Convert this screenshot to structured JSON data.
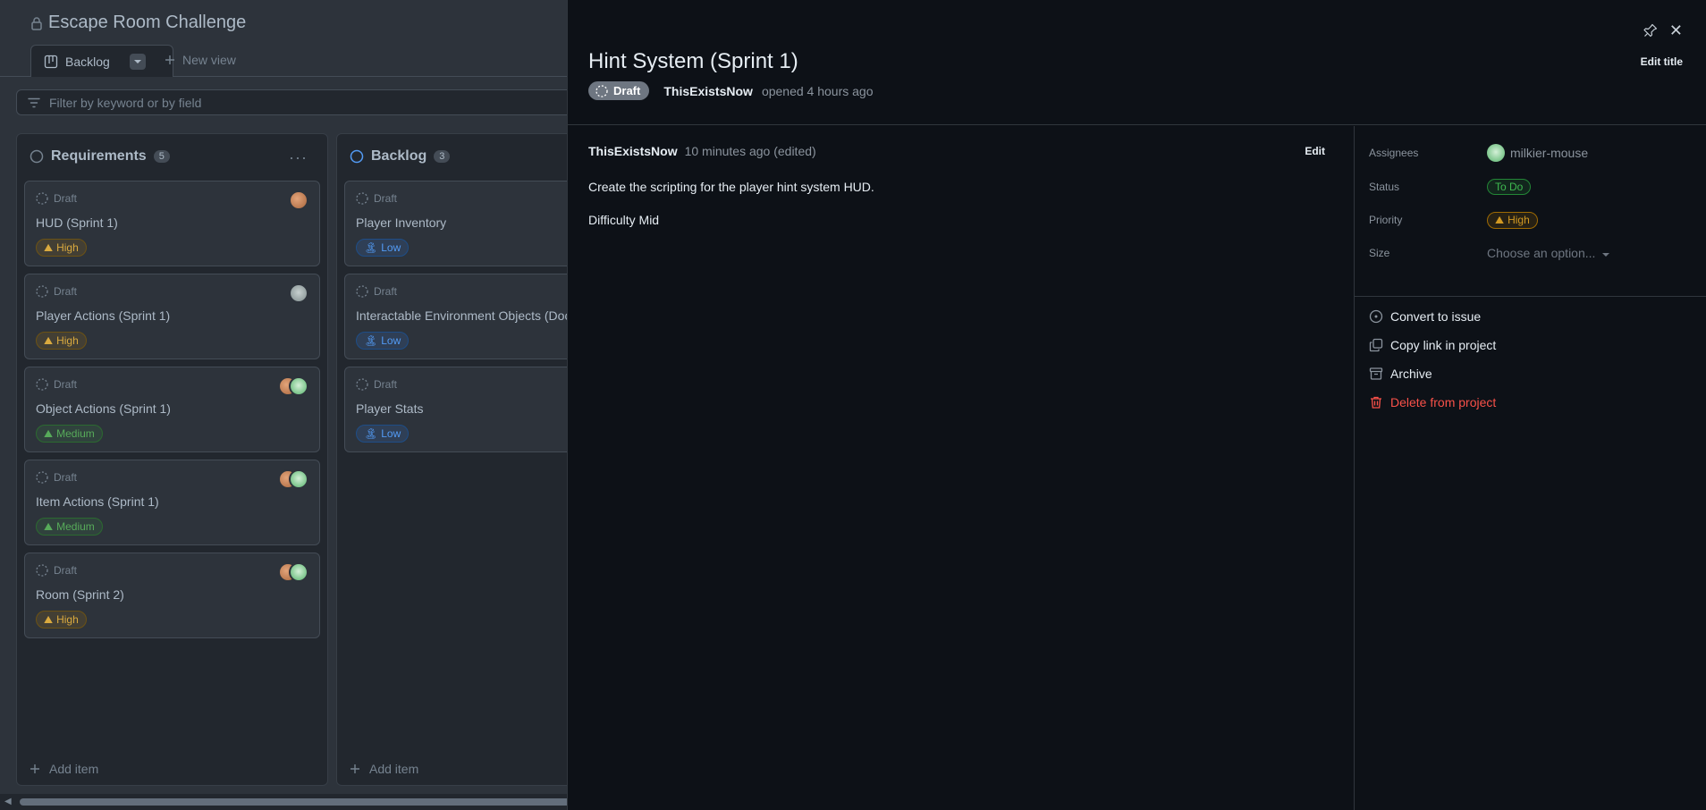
{
  "project": {
    "title": "Escape Room Challenge"
  },
  "views": {
    "active_tab": "Backlog",
    "new_view": "New view"
  },
  "filter": {
    "placeholder": "Filter by keyword or by field"
  },
  "columns": [
    {
      "title": "Requirements",
      "count": "5",
      "add_item": "Add item",
      "cards": [
        {
          "status": "Draft",
          "title": "HUD (Sprint 1)",
          "priority": "High"
        },
        {
          "status": "Draft",
          "title": "Player Actions (Sprint 1)",
          "priority": "High"
        },
        {
          "status": "Draft",
          "title": "Object Actions (Sprint 1)",
          "priority": "Medium"
        },
        {
          "status": "Draft",
          "title": "Item Actions (Sprint 1)",
          "priority": "Medium"
        },
        {
          "status": "Draft",
          "title": "Room (Sprint 2)",
          "priority": "High"
        }
      ]
    },
    {
      "title": "Backlog",
      "count": "3",
      "add_item": "Add item",
      "cards": [
        {
          "status": "Draft",
          "title": "Player Inventory",
          "priority": "Low"
        },
        {
          "status": "Draft",
          "title": "Interactable Environment Objects (Doc",
          "priority": "Low"
        },
        {
          "status": "Draft",
          "title": "Player Stats",
          "priority": "Low"
        }
      ]
    }
  ],
  "panel": {
    "title": "Hint System (Sprint 1)",
    "state": "Draft",
    "author": "ThisExistsNow",
    "opened": "opened 4 hours ago",
    "edit_title": "Edit title",
    "comment": {
      "author": "ThisExistsNow",
      "time": "10 minutes ago (edited)",
      "edit": "Edit",
      "line1": "Create the scripting for the player hint system HUD.",
      "line2": "Difficulty Mid"
    },
    "fields": {
      "assignees_label": "Assignees",
      "assignee": "milkier-mouse",
      "status_label": "Status",
      "status": "To Do",
      "priority_label": "Priority",
      "priority": "High",
      "size_label": "Size",
      "size_placeholder": "Choose an option..."
    },
    "actions": {
      "convert": "Convert to issue",
      "copy_link": "Copy link in project",
      "archive": "Archive",
      "delete": "Delete from project"
    }
  },
  "colors": {
    "high": "#daaa3f",
    "medium": "#57ab5a",
    "low": "#539bf5",
    "danger": "#f85149",
    "todo": "#3fb950"
  }
}
